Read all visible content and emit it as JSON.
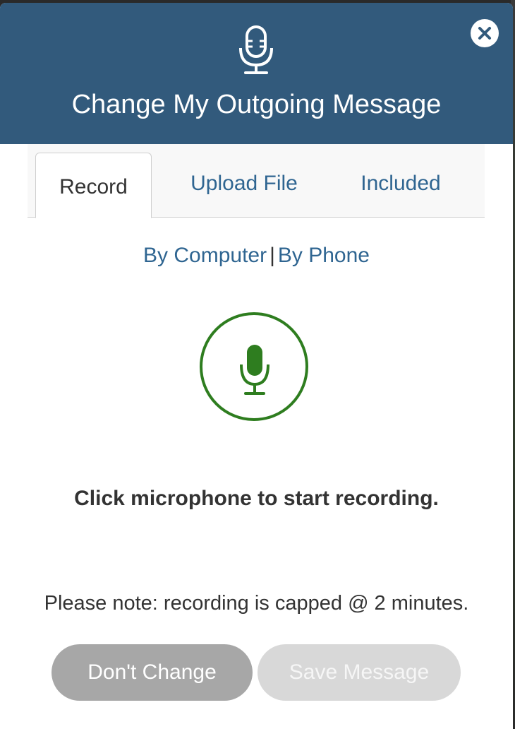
{
  "modal": {
    "title": "Change My Outgoing Message",
    "header_icon": "microphone-icon",
    "close_icon": "close-icon"
  },
  "tabs": [
    {
      "label": "Record",
      "active": true
    },
    {
      "label": "Upload File",
      "active": false
    },
    {
      "label": "Included",
      "active": false
    }
  ],
  "record": {
    "methods": [
      "By Computer",
      "By Phone"
    ],
    "separator": "|",
    "mic_icon": "microphone-icon",
    "instruction": "Click microphone to start recording.",
    "note": "Please note: recording is capped @ 2 minutes."
  },
  "buttons": {
    "dont_change": "Don't Change",
    "save_message": "Save Message"
  },
  "colors": {
    "header_bg": "#325a7c",
    "link": "#2f6591",
    "mic_green": "#2e7d1f",
    "button_gray": "#a7a7a7",
    "button_disabled": "#d8d8d8"
  }
}
